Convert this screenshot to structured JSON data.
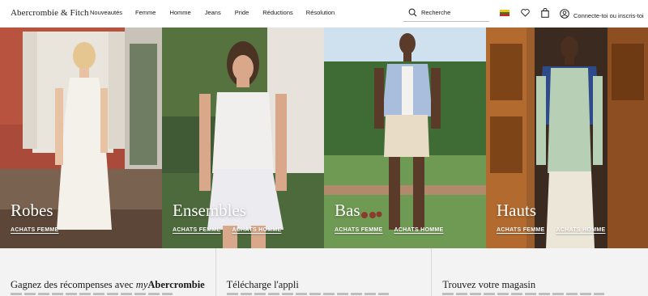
{
  "header": {
    "logo": "Abercrombie & Fitch",
    "nav": [
      "Nouveautés",
      "Femme",
      "Homme",
      "Jeans",
      "Pride",
      "Réductions",
      "Résolution"
    ],
    "search_label": "Recherche",
    "account_label": "Connecte-toi ou inscris-toi",
    "flag_colors": [
      "#f4c20d",
      "#2e7d32",
      "#c62828"
    ]
  },
  "tiles": [
    {
      "title": "Robes",
      "links": [
        "ACHATS FEMME"
      ]
    },
    {
      "title": "Ensembles",
      "links": [
        "ACHATS FEMME",
        "ACHATS HOMME"
      ]
    },
    {
      "title": "Bas",
      "links": [
        "ACHATS FEMME",
        "ACHATS HOMME"
      ]
    },
    {
      "title": "Hauts",
      "links": [
        "ACHATS FEMME",
        "ACHATS HOMME"
      ]
    }
  ],
  "info": {
    "rewards_prefix": "Gagnez des récompenses avec ",
    "rewards_my": "my",
    "rewards_brand": "Abercrombie",
    "app_title": "Télécharge l'appli",
    "store_title": "Trouvez votre magasin"
  }
}
